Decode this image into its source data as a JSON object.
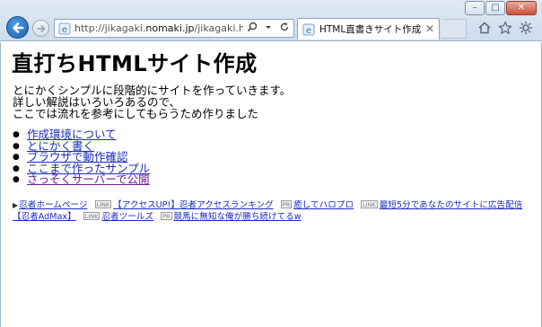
{
  "window": {
    "minimize": "–",
    "maximize": "□",
    "close": "✕"
  },
  "browser": {
    "url_prefix": "http://jikagaki.",
    "url_domain": "nomaki.jp",
    "url_path": "/jikagaki.html",
    "tab_title": "HTML直書きサイト作成",
    "icons": [
      "back-arrow-icon",
      "forward-arrow-icon",
      "search-icon",
      "dropdown-icon",
      "refresh-icon",
      "home-icon",
      "favorites-star-icon",
      "tools-gear-icon"
    ]
  },
  "page": {
    "title": "直打ちHTMLサイト作成",
    "intro": [
      "とにかくシンプルに段階的にサイトを作っていきます。",
      "詳しい解説はいろいろあるので、",
      "ここでは流れを参考にしてもらうため作りました"
    ],
    "toc": [
      {
        "label": "作成環境について",
        "visited": false
      },
      {
        "label": "とにかく書く",
        "visited": false
      },
      {
        "label": "ブラウザで動作確認",
        "visited": false
      },
      {
        "label": "ここまで作ったサンプル",
        "visited": false
      },
      {
        "label": "さっそくサーバーで公開",
        "visited": true
      }
    ],
    "ads": [
      {
        "badge": "",
        "label": "忍者ホームページ"
      },
      {
        "badge": "LINK",
        "label": "【アクセスUP!】忍者アクセスランキング"
      },
      {
        "badge": "PR",
        "label": "癒してハロプロ"
      },
      {
        "badge": "LINK",
        "label": "最短5分であなたのサイトに広告配信【忍者AdMax】"
      },
      {
        "badge": "LINK",
        "label": "忍者ツールズ"
      },
      {
        "badge": "PR",
        "label": "競馬に無知な俺が勝ち続けてるw"
      }
    ]
  }
}
